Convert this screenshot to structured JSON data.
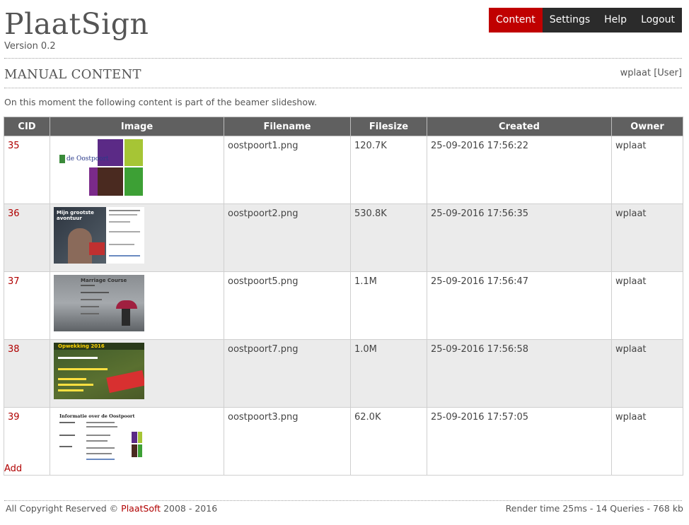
{
  "app": {
    "title": "PlaatSign",
    "version": "Version 0.2"
  },
  "nav": {
    "content": "Content",
    "settings": "Settings",
    "help": "Help",
    "logout": "Logout"
  },
  "page": {
    "title": "MANUAL CONTENT",
    "user": "wplaat [User]",
    "intro": "On this moment the following content is part of the beamer slideshow."
  },
  "table": {
    "headers": {
      "cid": "CID",
      "image": "Image",
      "filename": "Filename",
      "filesize": "Filesize",
      "created": "Created",
      "owner": "Owner"
    },
    "rows": [
      {
        "cid": "35",
        "filename": "oostpoort1.png",
        "filesize": "120.7K",
        "created": "25-09-2016 17:56:22",
        "owner": "wplaat",
        "thumb_text": "de Oostpoort"
      },
      {
        "cid": "36",
        "filename": "oostpoort2.png",
        "filesize": "530.8K",
        "created": "25-09-2016 17:56:35",
        "owner": "wplaat",
        "thumb_text": "Mijn grootste avontuur"
      },
      {
        "cid": "37",
        "filename": "oostpoort5.png",
        "filesize": "1.1M",
        "created": "25-09-2016 17:56:47",
        "owner": "wplaat",
        "thumb_text": "Marriage Course"
      },
      {
        "cid": "38",
        "filename": "oostpoort7.png",
        "filesize": "1.0M",
        "created": "25-09-2016 17:56:58",
        "owner": "wplaat",
        "thumb_text": "Opwekking 2016"
      },
      {
        "cid": "39",
        "filename": "oostpoort3.png",
        "filesize": "62.0K",
        "created": "25-09-2016 17:57:05",
        "owner": "wplaat",
        "thumb_text": "Informatie over de Oostpoort"
      }
    ]
  },
  "actions": {
    "add": "Add"
  },
  "footer": {
    "copyright_prefix": "All Copyright Reserved ©",
    "brand": "PlaatSoft",
    "years": "2008 - 2016",
    "render": "Render time 25ms - 14 Queries - 768 kb"
  },
  "colors": {
    "accent": "#c00000",
    "nav_bg": "#2b2b2b",
    "table_header_bg": "#606060",
    "row_alt_bg": "#ebebeb"
  }
}
